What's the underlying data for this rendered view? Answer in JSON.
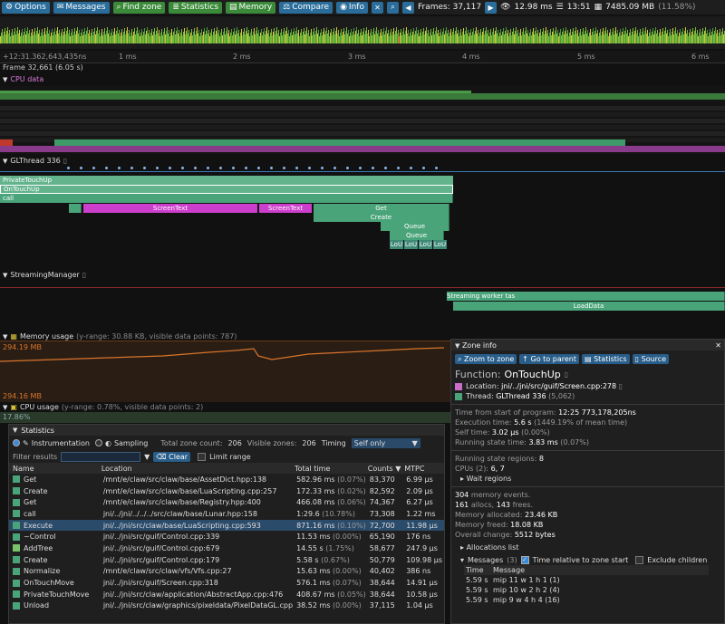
{
  "toolbar": {
    "options": "Options",
    "messages": "Messages",
    "find_zone": "Find zone",
    "statistics": "Statistics",
    "memory": "Memory",
    "compare": "Compare",
    "info": "Info",
    "frames": "Frames: 37,117",
    "time_a": "12.98 ms",
    "time_b": "13:51",
    "mem": "7485.09 MB",
    "mem_pct": "(11.58%)"
  },
  "ruler": {
    "origin": "+12:31.362,643,435ns",
    "ticks": [
      "1 ms",
      "2 ms",
      "3 ms",
      "4 ms",
      "5 ms",
      "6 ms"
    ]
  },
  "frame_label": "Frame 32,661 (6.05 s)",
  "sections": {
    "cpu_data": "CPU data",
    "glthread": "GLThread 336",
    "streaming": "StreamingManager",
    "memory_usage": "Memory usage",
    "memory_info": "(y-range: 30.88 KB, visible data points: 787)",
    "mem_top": "294.19 MB",
    "mem_bottom": "294.16 MB",
    "cpu_usage": "CPU usage",
    "cpu_usage_info": "(y-range: 0.78%, visible data points: 2)",
    "cpu_usage_val": "17.86%"
  },
  "glthread_zones": {
    "private_touch_up": "PrivateTouchUp",
    "on_touch_up": "OnTouchUp",
    "call": "call",
    "screen_text_1": "ScreenText",
    "screen_text_2": "ScreenText",
    "get": "Get",
    "create": "Create",
    "queue_1": "Queue",
    "queue_2": "Queue",
    "lou": "LoU"
  },
  "streaming_zones": {
    "stream": "Strea",
    "streaming": "Streaming",
    "worker": "Streaming worker tas",
    "load_data": "LoadData",
    "lou": "LoU",
    "loaddau": "LoadDaU"
  },
  "statistics": {
    "title": "Statistics",
    "instrumentation": "Instrumentation",
    "sampling": "Sampling",
    "total_zone_count_label": "Total zone count:",
    "total_zone_count": "206",
    "visible_zones_label": "Visible zones:",
    "visible_zones": "206",
    "timing_label": "Timing",
    "timing_value": "Self only",
    "filter_label": "Filter results",
    "clear": "Clear",
    "limit_range": "Limit range",
    "columns": [
      "Name",
      "Location",
      "Total time",
      "Counts",
      "MTPC"
    ],
    "rows": [
      {
        "name": "Get",
        "loc": "/mnt/e/claw/src/claw/base/AssetDict.hpp:138",
        "time": "582.96 ms",
        "pct": "(0.07%)",
        "count": "83,370",
        "mtpc": "6.99 μs",
        "color": "#4aa47a"
      },
      {
        "name": "Create",
        "loc": "/mnt/e/claw/src/claw/base/LuaScripting.cpp:257",
        "time": "172.33 ms",
        "pct": "(0.02%)",
        "count": "82,592",
        "mtpc": "2.09 μs",
        "color": "#4aa47a"
      },
      {
        "name": "Get",
        "loc": "/mnt/e/claw/src/claw/base/Registry.hpp:400",
        "time": "466.08 ms",
        "pct": "(0.06%)",
        "count": "74,367",
        "mtpc": "6.27 μs",
        "color": "#4aa47a"
      },
      {
        "name": "call",
        "loc": "jni/../jni/../../../src/claw/base/Lunar.hpp:158",
        "time": "1:29.6",
        "pct": "(10.78%)",
        "count": "73,308",
        "mtpc": "1.22 ms",
        "color": "#4aa47a"
      },
      {
        "name": "Execute",
        "loc": "jni/../jni/src/claw/base/LuaScripting.cpp:593",
        "time": "871.16 ms",
        "pct": "(0.10%)",
        "count": "72,700",
        "mtpc": "11.98 μs",
        "color": "#4aa47a"
      },
      {
        "name": "~Control",
        "loc": "jni/../jni/src/guif/Control.cpp:339",
        "time": "11.53 ms",
        "pct": "(0.00%)",
        "count": "65,190",
        "mtpc": "176 ns",
        "color": "#4aa47a"
      },
      {
        "name": "AddTree",
        "loc": "jni/../jni/src/guif/Control.cpp:679",
        "time": "14.55 s",
        "pct": "(1.75%)",
        "count": "58,677",
        "mtpc": "247.9 μs",
        "color": "#7ac36a"
      },
      {
        "name": "Create",
        "loc": "jni/../jni/src/guif/Control.cpp:179",
        "time": "5.58 s",
        "pct": "(0.67%)",
        "count": "50,779",
        "mtpc": "109.98 μs",
        "color": "#4aa47a"
      },
      {
        "name": "Normalize",
        "loc": "/mnt/e/claw/src/claw/vfs/Vfs.cpp:27",
        "time": "15.63 ms",
        "pct": "(0.00%)",
        "count": "40,402",
        "mtpc": "386 ns",
        "color": "#4aa47a"
      },
      {
        "name": "OnTouchMove",
        "loc": "jni/../jni/src/guif/Screen.cpp:318",
        "time": "576.1 ms",
        "pct": "(0.07%)",
        "count": "38,644",
        "mtpc": "14.91 μs",
        "color": "#4aa47a"
      },
      {
        "name": "PrivateTouchMove",
        "loc": "jni/../jni/src/claw/application/AbstractApp.cpp:476",
        "time": "408.67 ms",
        "pct": "(0.05%)",
        "count": "38,644",
        "mtpc": "10.58 μs",
        "color": "#4aa47a"
      },
      {
        "name": "Unload",
        "loc": "jni/../jni/src/claw/graphics/pixeldata/PixelDataGL.cpp",
        "time": "38.52 ms",
        "pct": "(0.00%)",
        "count": "37,115",
        "mtpc": "1.04 μs",
        "color": "#4aa47a"
      }
    ]
  },
  "zone_info": {
    "title": "Zone info",
    "zoom": "Zoom to zone",
    "parent": "Go to parent",
    "statistics": "Statistics",
    "source": "Source",
    "function_label": "Function:",
    "function": "OnTouchUp",
    "location_label": "Location:",
    "location": "jni/../jni/src/guif/Screen.cpp:278",
    "thread_label": "Thread:",
    "thread": "GLThread 336",
    "thread_id": "(5,062)",
    "time_from_start_label": "Time from start of program:",
    "time_from_start": "12:25 773,178,205ns",
    "exec_label": "Execution time:",
    "exec": "5.6 s",
    "exec_extra": "(1449.19% of mean time)",
    "self_label": "Self time:",
    "self": "3.02 μs",
    "self_extra": "(0.00%)",
    "running_label": "Running state time:",
    "running": "3.83 ms",
    "running_extra": "(0.07%)",
    "regions_label": "Running state regions:",
    "regions": "8",
    "cpus_label": "CPUs (2):",
    "cpus": "6, 7",
    "wait_regions": "Wait regions",
    "mem_events": "304",
    "mem_events_label": "memory events.",
    "allocs": "161",
    "allocs_label": "allocs,",
    "frees": "143",
    "frees_label": "frees.",
    "mem_alloc_label": "Memory allocated:",
    "mem_alloc": "23.46 KB",
    "mem_freed_label": "Memory freed:",
    "mem_freed": "18.08 KB",
    "overall_label": "Overall change:",
    "overall": "5512 bytes",
    "allocations_list": "Allocations list",
    "messages_label": "Messages",
    "messages_count": "(3)",
    "time_relative": "Time relative to zone start",
    "exclude_children": "Exclude children",
    "msg_cols": [
      "Time",
      "Message"
    ],
    "messages": [
      {
        "time": "5.59 s",
        "msg": "mip 11  w 1  h 1 (1)"
      },
      {
        "time": "5.59 s",
        "msg": "mip 10  w 2  h 2 (4)"
      },
      {
        "time": "5.59 s",
        "msg": "mip 9  w 4  h 4 (16)"
      }
    ]
  },
  "colors": {
    "accent_blue": "#2a6d9a",
    "zone_green": "#4aa47a",
    "zone_magenta": "#cc3fcc",
    "memory_line": "#d9742b",
    "selection": "#2b4b6b"
  }
}
